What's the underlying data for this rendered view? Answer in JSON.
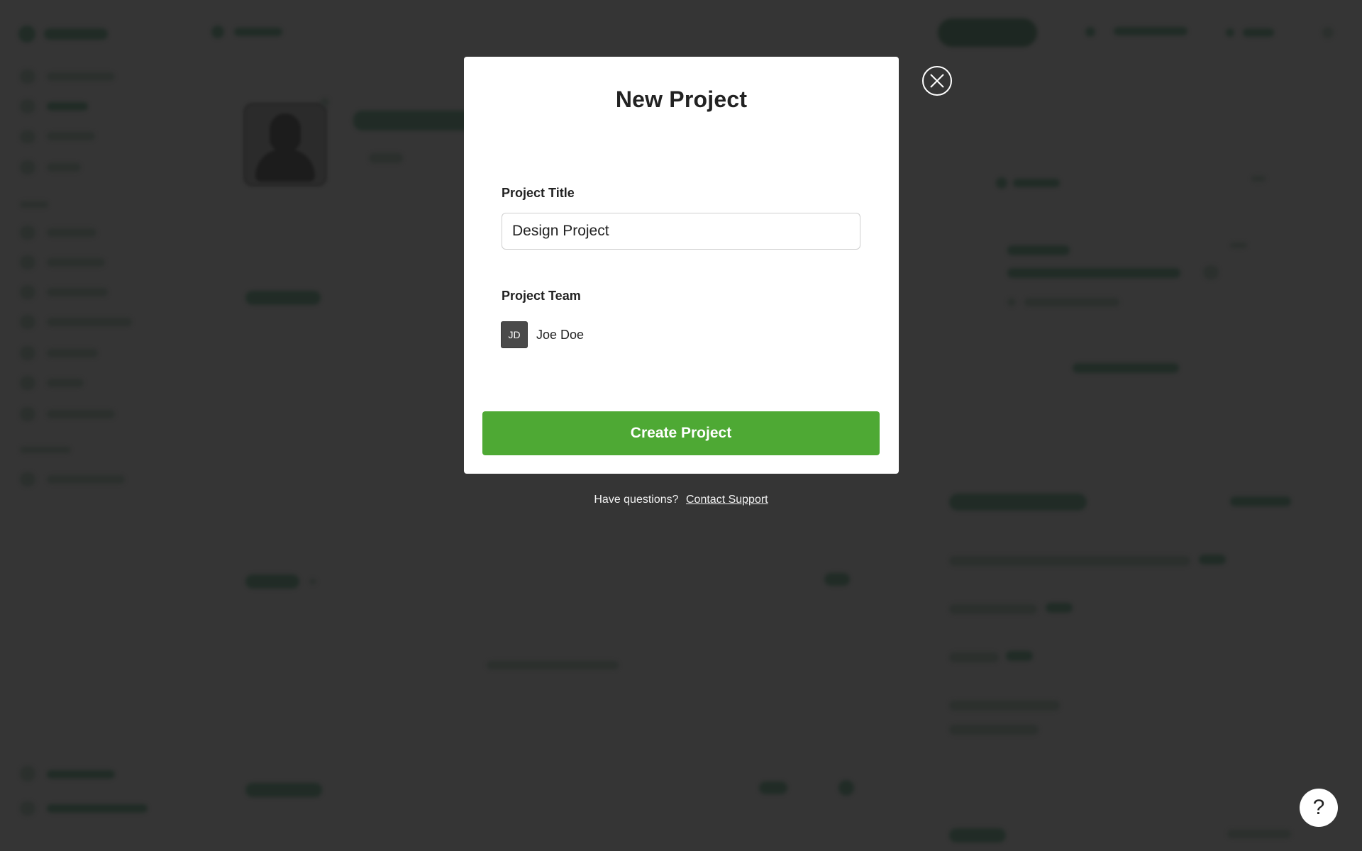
{
  "modal": {
    "title": "New Project",
    "project_title_label": "Project Title",
    "project_title_value": "Design Project",
    "project_team_label": "Project Team",
    "team_members": [
      {
        "initials": "JD",
        "name": "Joe Doe"
      }
    ],
    "create_button_label": "Create Project"
  },
  "footer": {
    "question_text": "Have questions?",
    "support_link": "Contact Support"
  },
  "help": {
    "label": "?"
  },
  "colors": {
    "primary_button": "#4ea934",
    "overlay": "#353535",
    "modal_background": "#ffffff"
  },
  "icons": {
    "close": "close-icon",
    "help": "help-icon"
  }
}
